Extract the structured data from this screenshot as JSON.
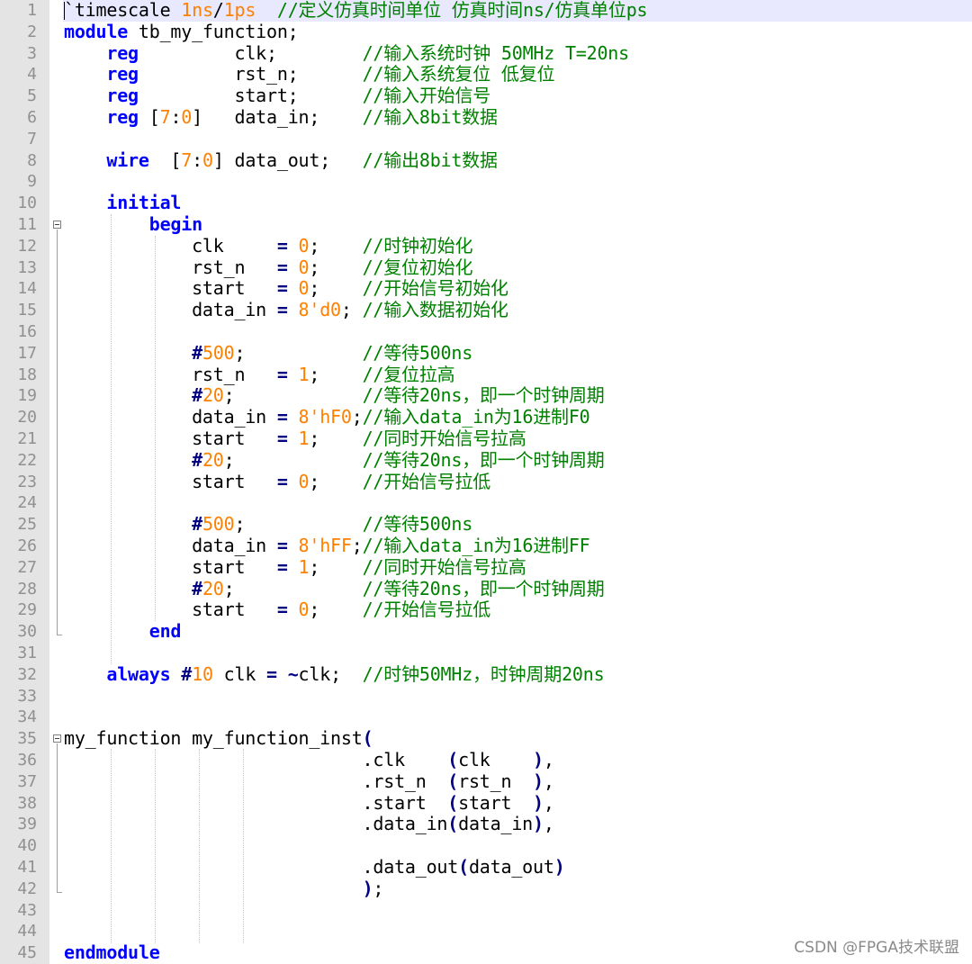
{
  "editor": {
    "language": "verilog",
    "current_line": 1,
    "lines": [
      [
        [
          "`timescale ",
          ""
        ],
        [
          "1ns",
          "num"
        ],
        [
          "/",
          ""
        ],
        [
          "1ps",
          "num"
        ],
        [
          "  //定义仿真时间单位 仿真时间ns/仿真单位ps",
          "cm"
        ]
      ],
      [
        [
          "module",
          "kw"
        ],
        [
          " tb_my_function;",
          ""
        ]
      ],
      [
        [
          "    ",
          ""
        ],
        [
          "reg",
          "kw"
        ],
        [
          "         clk;        ",
          ""
        ],
        [
          "//输入系统时钟 50MHz T=20ns",
          "cm"
        ]
      ],
      [
        [
          "    ",
          ""
        ],
        [
          "reg",
          "kw"
        ],
        [
          "         rst_n;      ",
          ""
        ],
        [
          "//输入系统复位 低复位",
          "cm"
        ]
      ],
      [
        [
          "    ",
          ""
        ],
        [
          "reg",
          "kw"
        ],
        [
          "         start;      ",
          ""
        ],
        [
          "//输入开始信号",
          "cm"
        ]
      ],
      [
        [
          "    ",
          ""
        ],
        [
          "reg",
          "kw"
        ],
        [
          " [",
          ""
        ],
        [
          "7",
          "num"
        ],
        [
          ":",
          ""
        ],
        [
          "0",
          "num"
        ],
        [
          "]   data_in;    ",
          ""
        ],
        [
          "//输入8bit数据",
          "cm"
        ]
      ],
      [],
      [
        [
          "    ",
          ""
        ],
        [
          "wire",
          "kw"
        ],
        [
          "  [",
          ""
        ],
        [
          "7",
          "num"
        ],
        [
          ":",
          ""
        ],
        [
          "0",
          "num"
        ],
        [
          "] data_out;   ",
          ""
        ],
        [
          "//输出8bit数据",
          "cm"
        ]
      ],
      [],
      [
        [
          "    ",
          ""
        ],
        [
          "initial",
          "kw"
        ]
      ],
      [
        [
          "        ",
          ""
        ],
        [
          "begin",
          "kw"
        ]
      ],
      [
        [
          "            clk     ",
          ""
        ],
        [
          "=",
          "op"
        ],
        [
          " ",
          ""
        ],
        [
          "0",
          "num"
        ],
        [
          ";    ",
          ""
        ],
        [
          "//时钟初始化",
          "cm"
        ]
      ],
      [
        [
          "            rst_n   ",
          ""
        ],
        [
          "=",
          "op"
        ],
        [
          " ",
          ""
        ],
        [
          "0",
          "num"
        ],
        [
          ";    ",
          ""
        ],
        [
          "//复位初始化",
          "cm"
        ]
      ],
      [
        [
          "            start   ",
          ""
        ],
        [
          "=",
          "op"
        ],
        [
          " ",
          ""
        ],
        [
          "0",
          "num"
        ],
        [
          ";    ",
          ""
        ],
        [
          "//开始信号初始化",
          "cm"
        ]
      ],
      [
        [
          "            data_in ",
          ""
        ],
        [
          "=",
          "op"
        ],
        [
          " ",
          ""
        ],
        [
          "8'd0",
          "num"
        ],
        [
          "; ",
          ""
        ],
        [
          "//输入数据初始化",
          "cm"
        ]
      ],
      [],
      [
        [
          "            ",
          ""
        ],
        [
          "#",
          "op"
        ],
        [
          "500",
          "num"
        ],
        [
          ";           ",
          ""
        ],
        [
          "//等待500ns",
          "cm"
        ]
      ],
      [
        [
          "            rst_n   ",
          ""
        ],
        [
          "=",
          "op"
        ],
        [
          " ",
          ""
        ],
        [
          "1",
          "num"
        ],
        [
          ";    ",
          ""
        ],
        [
          "//复位拉高",
          "cm"
        ]
      ],
      [
        [
          "            ",
          ""
        ],
        [
          "#",
          "op"
        ],
        [
          "20",
          "num"
        ],
        [
          ";            ",
          ""
        ],
        [
          "//等待20ns，即一个时钟周期",
          "cm"
        ]
      ],
      [
        [
          "            data_in ",
          ""
        ],
        [
          "=",
          "op"
        ],
        [
          " ",
          ""
        ],
        [
          "8'hF0",
          "num"
        ],
        [
          ";",
          ""
        ],
        [
          "//输入data_in为16进制F0",
          "cm"
        ]
      ],
      [
        [
          "            start   ",
          ""
        ],
        [
          "=",
          "op"
        ],
        [
          " ",
          ""
        ],
        [
          "1",
          "num"
        ],
        [
          ";    ",
          ""
        ],
        [
          "//同时开始信号拉高",
          "cm"
        ]
      ],
      [
        [
          "            ",
          ""
        ],
        [
          "#",
          "op"
        ],
        [
          "20",
          "num"
        ],
        [
          ";            ",
          ""
        ],
        [
          "//等待20ns，即一个时钟周期",
          "cm"
        ]
      ],
      [
        [
          "            start   ",
          ""
        ],
        [
          "=",
          "op"
        ],
        [
          " ",
          ""
        ],
        [
          "0",
          "num"
        ],
        [
          ";    ",
          ""
        ],
        [
          "//开始信号拉低",
          "cm"
        ]
      ],
      [],
      [
        [
          "            ",
          ""
        ],
        [
          "#",
          "op"
        ],
        [
          "500",
          "num"
        ],
        [
          ";           ",
          ""
        ],
        [
          "//等待500ns",
          "cm"
        ]
      ],
      [
        [
          "            data_in ",
          ""
        ],
        [
          "=",
          "op"
        ],
        [
          " ",
          ""
        ],
        [
          "8'hFF",
          "num"
        ],
        [
          ";",
          ""
        ],
        [
          "//输入data_in为16进制FF",
          "cm"
        ]
      ],
      [
        [
          "            start   ",
          ""
        ],
        [
          "=",
          "op"
        ],
        [
          " ",
          ""
        ],
        [
          "1",
          "num"
        ],
        [
          ";    ",
          ""
        ],
        [
          "//同时开始信号拉高",
          "cm"
        ]
      ],
      [
        [
          "            ",
          ""
        ],
        [
          "#",
          "op"
        ],
        [
          "20",
          "num"
        ],
        [
          ";            ",
          ""
        ],
        [
          "//等待20ns，即一个时钟周期",
          "cm"
        ]
      ],
      [
        [
          "            start   ",
          ""
        ],
        [
          "=",
          "op"
        ],
        [
          " ",
          ""
        ],
        [
          "0",
          "num"
        ],
        [
          ";    ",
          ""
        ],
        [
          "//开始信号拉低",
          "cm"
        ]
      ],
      [
        [
          "        ",
          ""
        ],
        [
          "end",
          "kw"
        ]
      ],
      [],
      [
        [
          "    ",
          ""
        ],
        [
          "always",
          "kw"
        ],
        [
          " ",
          ""
        ],
        [
          "#",
          "op"
        ],
        [
          "10",
          "num"
        ],
        [
          " clk ",
          ""
        ],
        [
          "=",
          "op"
        ],
        [
          " ",
          ""
        ],
        [
          "~",
          "op"
        ],
        [
          "clk;  ",
          ""
        ],
        [
          "//时钟50MHz，时钟周期20ns",
          "cm"
        ]
      ],
      [],
      [],
      [
        [
          "my_function my_function_inst",
          ""
        ],
        [
          "(",
          "op"
        ]
      ],
      [
        [
          "                            .clk    ",
          ""
        ],
        [
          "(",
          "op"
        ],
        [
          "clk    ",
          ""
        ],
        [
          ")",
          "op"
        ],
        [
          ",",
          ""
        ]
      ],
      [
        [
          "                            .rst_n  ",
          ""
        ],
        [
          "(",
          "op"
        ],
        [
          "rst_n  ",
          ""
        ],
        [
          ")",
          "op"
        ],
        [
          ",",
          ""
        ]
      ],
      [
        [
          "                            .start  ",
          ""
        ],
        [
          "(",
          "op"
        ],
        [
          "start  ",
          ""
        ],
        [
          ")",
          "op"
        ],
        [
          ",",
          ""
        ]
      ],
      [
        [
          "                            .data_in",
          ""
        ],
        [
          "(",
          "op"
        ],
        [
          "data_in",
          ""
        ],
        [
          ")",
          "op"
        ],
        [
          ",",
          ""
        ]
      ],
      [],
      [
        [
          "                            .data_out",
          ""
        ],
        [
          "(",
          "op"
        ],
        [
          "data_out",
          ""
        ],
        [
          ")",
          "op"
        ]
      ],
      [
        [
          "                            ",
          ""
        ],
        [
          ")",
          "op"
        ],
        [
          ";",
          ""
        ]
      ],
      [],
      [],
      [
        [
          "endmodule",
          "kw"
        ]
      ]
    ]
  },
  "watermark": "CSDN @FPGA技术联盟"
}
